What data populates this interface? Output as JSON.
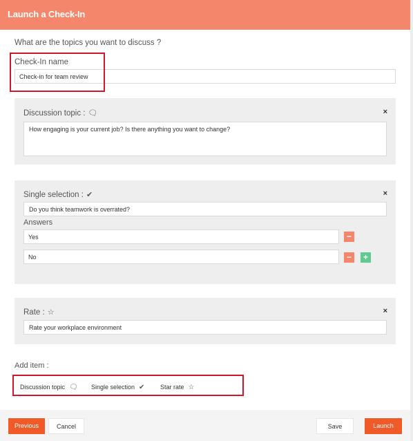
{
  "header": {
    "title": "Launch a Check-In"
  },
  "form": {
    "question": "What are the topics you want to discuss ?",
    "name_label": "Check-In name",
    "name_value": "Check-in for team review"
  },
  "discussion": {
    "title": "Discussion topic :",
    "icon": "chat-bubble-icon",
    "close": "×",
    "text": "How engaging is your current job? Is there anything you want to change?"
  },
  "single": {
    "title": "Single selection :",
    "icon": "check-icon",
    "close": "×",
    "question": "Do you think teamwork is overrated?",
    "answers_label": "Answers",
    "answers": [
      "Yes",
      "No"
    ],
    "minus": "−",
    "plus": "+"
  },
  "rate": {
    "title": "Rate :",
    "icon": "star-icon",
    "close": "×",
    "text": "Rate your workplace environment"
  },
  "add_item": {
    "label": "Add item :",
    "options": [
      {
        "label": "Discussion topic",
        "icon": "chat-bubble-icon"
      },
      {
        "label": "Single selection",
        "icon": "check-icon"
      },
      {
        "label": "Star rate",
        "icon": "star-icon"
      }
    ]
  },
  "footer": {
    "previous": "Previous",
    "cancel": "Cancel",
    "save": "Save",
    "launch": "Launch"
  },
  "colors": {
    "header": "#f4876b",
    "primary_button": "#f05a28",
    "minus_button": "#f4876b",
    "plus_button": "#5fcb8e",
    "highlight_box": "#d0162a",
    "card_background": "#eeeeee"
  }
}
